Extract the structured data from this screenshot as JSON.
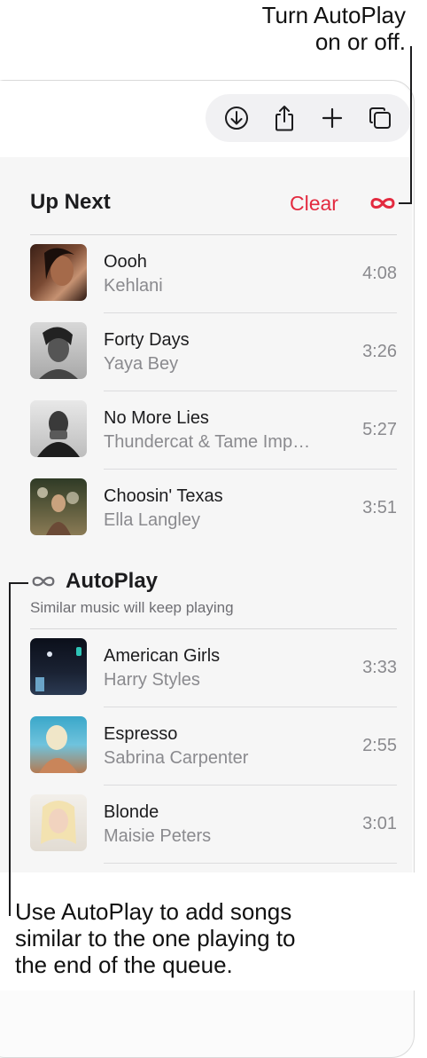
{
  "callouts": {
    "top_line1": "Turn AutoPlay",
    "top_line2": "on or off.",
    "bottom_line1": "Use AutoPlay to add songs",
    "bottom_line2": "similar to the one playing to",
    "bottom_line3": "the end of the queue."
  },
  "toolbar": {
    "icons": [
      "download-icon",
      "share-icon",
      "add-icon",
      "copy-icon"
    ]
  },
  "up_next": {
    "title": "Up Next",
    "clear_label": "Clear",
    "autoplay_icon": "infinity-icon",
    "accent_color": "#e32a3f",
    "tracks": [
      {
        "title": "Oooh",
        "artist": "Kehlani",
        "duration": "4:08"
      },
      {
        "title": "Forty Days",
        "artist": "Yaya Bey",
        "duration": "3:26"
      },
      {
        "title": "No More Lies",
        "artist": "Thundercat & Tame Imp…",
        "duration": "5:27"
      },
      {
        "title": "Choosin' Texas",
        "artist": "Ella Langley",
        "duration": "3:51"
      }
    ]
  },
  "autoplay": {
    "title": "AutoPlay",
    "subtitle": "Similar music will keep playing",
    "tracks": [
      {
        "title": "American Girls",
        "artist": "Harry Styles",
        "duration": "3:33"
      },
      {
        "title": "Espresso",
        "artist": "Sabrina Carpenter",
        "duration": "2:55"
      },
      {
        "title": "Blonde",
        "artist": "Maisie Peters",
        "duration": "3:01"
      }
    ]
  }
}
